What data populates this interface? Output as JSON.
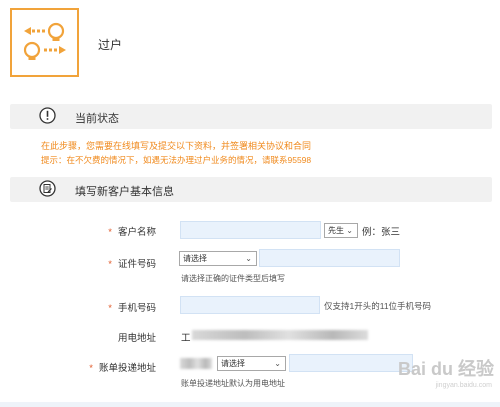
{
  "header": {
    "title": "过户",
    "logo_icon": "transfer-bulbs-icon"
  },
  "status_section": {
    "title": "当前状态",
    "icon": "exclamation-circle-icon",
    "message_line1": "在此步骤，您需要在线填写及提交以下资料，并签署相关协议和合同",
    "message_line2": "提示：在不欠费的情况下，如遇无法办理过户业务的情况，请联系95598"
  },
  "form_section": {
    "title": "填写新客户基本信息",
    "icon": "form-edit-icon",
    "customer_name": {
      "required_mark": "*",
      "label": "客户名称",
      "value": "",
      "title_select": "先生",
      "example": "例：张三"
    },
    "id_number": {
      "required_mark": "*",
      "label": "证件号码",
      "type_select": "请选择",
      "value": "",
      "hint": "请选择正确的证件类型后填写"
    },
    "phone": {
      "required_mark": "*",
      "label": "手机号码",
      "value": "",
      "hint": "仅支持1开头的11位手机号码"
    },
    "electric_address": {
      "label": "用电地址",
      "value_prefix": "工"
    },
    "bill_address": {
      "required_mark": "*",
      "label": "账单投递地址",
      "select": "请选择",
      "value": "",
      "hint": "账单投递地址默认为用电地址"
    }
  },
  "watermark": {
    "brand": "Bai du 经验",
    "url": "jingyan.baidu.com"
  },
  "colors": {
    "accent": "#f1a33a",
    "alert": "#f08a1d",
    "input_bg": "#e9f2fc",
    "section_bg": "#f1f1f1"
  }
}
